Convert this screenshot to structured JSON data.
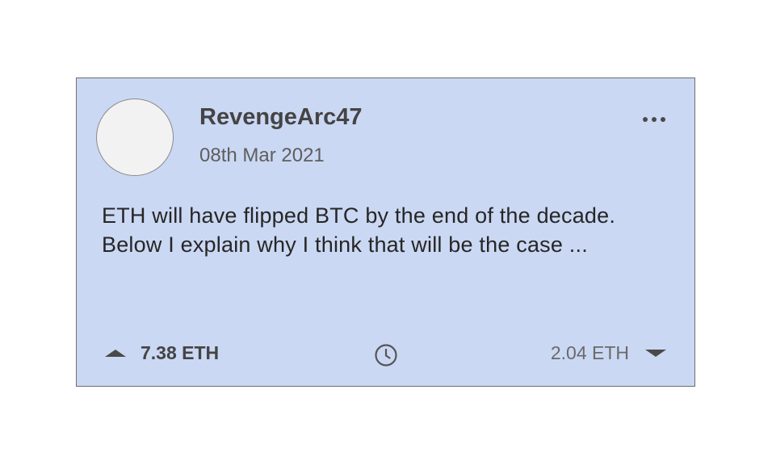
{
  "post": {
    "author": "RevengeArc47",
    "date": "08th Mar 2021",
    "body": "ETH will have flipped BTC by the end of the decade. Below I explain why I think that will be the case ...",
    "more_icon": "more-horizontal-icon",
    "upvote": {
      "icon": "triangle-up-icon",
      "amount": "7.38 ETH"
    },
    "time_icon": "clock-icon",
    "downvote": {
      "icon": "triangle-down-icon",
      "amount": "2.04 ETH"
    }
  },
  "colors": {
    "card_background": "#cbd8f3",
    "card_border": "#6e6e6e",
    "text_dark": "#444444",
    "text_muted": "#5e5e5e"
  }
}
